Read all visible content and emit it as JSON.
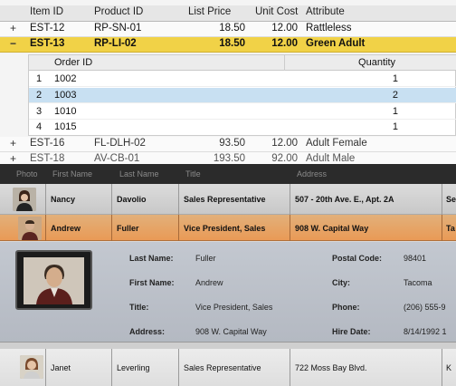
{
  "top_grid": {
    "columns": [
      "Item ID",
      "Product ID",
      "List Price",
      "Unit Cost",
      "Attribute"
    ],
    "rows": [
      {
        "expander": "+",
        "item_id": "EST-12",
        "product_id": "RP-SN-01",
        "list_price": "18.50",
        "unit_cost": "12.00",
        "attribute": "Rattleless"
      },
      {
        "expander": "−",
        "item_id": "EST-13",
        "product_id": "RP-LI-02",
        "list_price": "18.50",
        "unit_cost": "12.00",
        "attribute": "Green Adult"
      },
      {
        "expander": "+",
        "item_id": "EST-16",
        "product_id": "FL-DLH-02",
        "list_price": "93.50",
        "unit_cost": "12.00",
        "attribute": "Adult Female"
      },
      {
        "expander": "+",
        "item_id": "EST-18",
        "product_id": "AV-CB-01",
        "list_price": "193.50",
        "unit_cost": "92.00",
        "attribute": "Adult Male"
      }
    ],
    "detail": {
      "columns": [
        "Order ID",
        "Quantity"
      ],
      "rows": [
        {
          "n": "1",
          "order_id": "1002",
          "quantity": "1"
        },
        {
          "n": "2",
          "order_id": "1003",
          "quantity": "2"
        },
        {
          "n": "3",
          "order_id": "1010",
          "quantity": "1"
        },
        {
          "n": "4",
          "order_id": "1015",
          "quantity": "1"
        }
      ]
    }
  },
  "bottom_grid": {
    "columns": [
      "Photo",
      "First Name",
      "Last Name",
      "Title",
      "Address"
    ],
    "rows": [
      {
        "first": "Nancy",
        "last": "Davolio",
        "title": "Sales Representative",
        "address": "507 - 20th Ave. E., Apt. 2A",
        "extra": "Se"
      },
      {
        "first": "Andrew",
        "last": "Fuller",
        "title": "Vice President, Sales",
        "address": "908 W. Capital Way",
        "extra": "Ta"
      },
      {
        "first": "Janet",
        "last": "Leverling",
        "title": "Sales Representative",
        "address": "722 Moss Bay Blvd.",
        "extra": "K"
      }
    ],
    "detail": {
      "last_name_label": "Last Name:",
      "last_name": "Fuller",
      "first_name_label": "First Name:",
      "first_name": "Andrew",
      "title_label": "Title:",
      "title": "Vice President, Sales",
      "address_label": "Address:",
      "address": "908 W. Capital Way",
      "postal_label": "Postal Code:",
      "postal": "98401",
      "city_label": "City:",
      "city": "Tacoma",
      "phone_label": "Phone:",
      "phone": "(206) 555-9",
      "hire_label": "Hire Date:",
      "hire": "8/14/1992 1"
    }
  }
}
